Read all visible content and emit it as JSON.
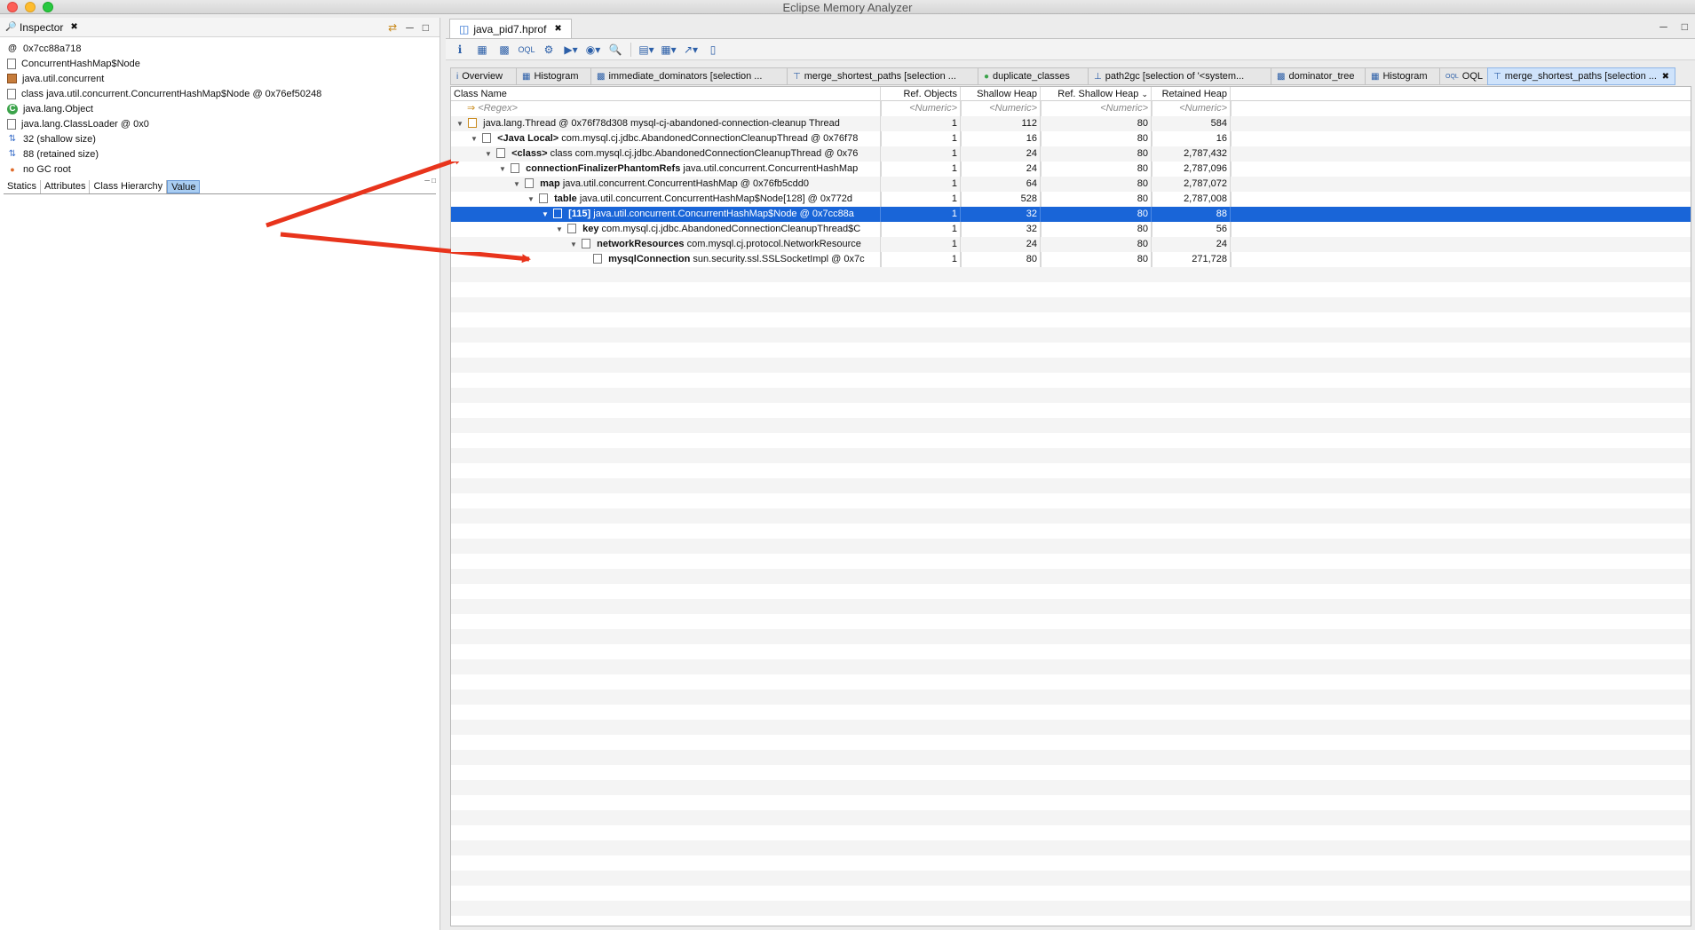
{
  "window": {
    "title": "Eclipse Memory Analyzer"
  },
  "inspector": {
    "tab_label": "Inspector",
    "rows": [
      {
        "icon": "at-icon",
        "text": "0x7cc88a718"
      },
      {
        "icon": "class-file-icon",
        "text": "ConcurrentHashMap$Node"
      },
      {
        "icon": "package-icon",
        "text": "java.util.concurrent"
      },
      {
        "icon": "class-object-icon",
        "text": "class java.util.concurrent.ConcurrentHashMap$Node @ 0x76ef50248"
      },
      {
        "icon": "superclass-icon",
        "text": "java.lang.Object"
      },
      {
        "icon": "classloader-icon",
        "text": "java.lang.ClassLoader @ 0x0"
      },
      {
        "icon": "shallow-size-icon",
        "text": "32 (shallow size)"
      },
      {
        "icon": "retained-size-icon",
        "text": "88 (retained size)"
      },
      {
        "icon": "gc-root-icon",
        "text": "no GC root"
      }
    ],
    "tabs": [
      "Statics",
      "Attributes",
      "Class Hierarchy",
      "Value"
    ],
    "active_tab": "Value"
  },
  "editor": {
    "file_tab": "java_pid7.hprof",
    "result_tabs": [
      {
        "label": "Overview",
        "icon": "info-icon"
      },
      {
        "label": "Histogram",
        "icon": "histogram-icon"
      },
      {
        "label": "immediate_dominators   [selection ...",
        "icon": "tree-icon"
      },
      {
        "label": "merge_shortest_paths   [selection ...",
        "icon": "merge-icon"
      },
      {
        "label": "duplicate_classes",
        "icon": "class-icon"
      },
      {
        "label": "path2gc   [selection of '<system...",
        "icon": "path-icon"
      },
      {
        "label": "dominator_tree",
        "icon": "tree-icon"
      },
      {
        "label": "Histogram",
        "icon": "histogram-icon"
      },
      {
        "label": "OQL",
        "icon": "oql-icon"
      },
      {
        "label": "merge_shortest_paths   [selection ...",
        "icon": "merge-icon",
        "active": true
      }
    ]
  },
  "table": {
    "columns": {
      "class_name": "Class Name",
      "ref_objects": "Ref. Objects",
      "shallow_heap": "Shallow Heap",
      "ref_shallow_heap": "Ref. Shallow Heap",
      "retained_heap": "Retained Heap"
    },
    "filter_row": {
      "name": "<Regex>",
      "ref": "<Numeric>",
      "shallow": "<Numeric>",
      "rshallow": "<Numeric>",
      "retained": "<Numeric>"
    },
    "rows": [
      {
        "field": "",
        "name": "java.lang.Thread @ 0x76f78d308  mysql-cj-abandoned-connection-cleanup  Thread",
        "ref": "1",
        "shallow": "112",
        "rshallow": "80",
        "retained": "584"
      },
      {
        "field": "<Java Local>",
        "name": "com.mysql.cj.jdbc.AbandonedConnectionCleanupThread @ 0x76f78",
        "ref": "1",
        "shallow": "16",
        "rshallow": "80",
        "retained": "16"
      },
      {
        "field": "<class>",
        "name": "class com.mysql.cj.jdbc.AbandonedConnectionCleanupThread @ 0x76",
        "ref": "1",
        "shallow": "24",
        "rshallow": "80",
        "retained": "2,787,432"
      },
      {
        "field": "connectionFinalizerPhantomRefs",
        "name": "java.util.concurrent.ConcurrentHashMap",
        "ref": "1",
        "shallow": "24",
        "rshallow": "80",
        "retained": "2,787,096"
      },
      {
        "field": "map",
        "name": "java.util.concurrent.ConcurrentHashMap @ 0x76fb5cdd0",
        "ref": "1",
        "shallow": "64",
        "rshallow": "80",
        "retained": "2,787,072"
      },
      {
        "field": "table",
        "name": "java.util.concurrent.ConcurrentHashMap$Node[128] @ 0x772d",
        "ref": "1",
        "shallow": "528",
        "rshallow": "80",
        "retained": "2,787,008"
      },
      {
        "field": "[115]",
        "name": "java.util.concurrent.ConcurrentHashMap$Node @ 0x7cc88a",
        "ref": "1",
        "shallow": "32",
        "rshallow": "80",
        "retained": "88",
        "selected": true
      },
      {
        "field": "key",
        "name": "com.mysql.cj.jdbc.AbandonedConnectionCleanupThread$C",
        "ref": "1",
        "shallow": "32",
        "rshallow": "80",
        "retained": "56"
      },
      {
        "field": "networkResources",
        "name": "com.mysql.cj.protocol.NetworkResource",
        "ref": "1",
        "shallow": "24",
        "rshallow": "80",
        "retained": "24"
      },
      {
        "field": "mysqlConnection",
        "name": "sun.security.ssl.SSLSocketImpl @ 0x7c",
        "ref": "1",
        "shallow": "80",
        "rshallow": "80",
        "retained": "271,728"
      }
    ]
  },
  "colors": {
    "selection": "#1965d8",
    "annotation_arrow": "#e8341c"
  }
}
